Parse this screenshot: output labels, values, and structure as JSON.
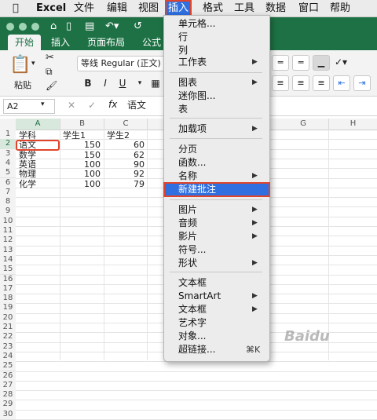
{
  "menubar": {
    "apple": "",
    "app": "Excel",
    "items": [
      "文件",
      "编辑",
      "视图",
      "插入",
      "格式",
      "工具",
      "数据",
      "窗口",
      "帮助"
    ]
  },
  "ribbon_tabs": [
    "开始",
    "插入",
    "页面布局",
    "公式"
  ],
  "ribbon": {
    "paste_label": "粘贴",
    "font_name": "等线 Regular (正文)",
    "bold": "B",
    "italic": "I",
    "underline": "U"
  },
  "formula_bar": {
    "name_box": "A2",
    "fx": "fx",
    "value": "语文"
  },
  "columns": [
    "A",
    "B",
    "C",
    "G",
    "H"
  ],
  "rows": [
    "1",
    "2",
    "3",
    "4",
    "5",
    "6",
    "7",
    "8",
    "9",
    "10",
    "11",
    "12",
    "13",
    "14",
    "15",
    "16",
    "17",
    "18",
    "19",
    "20",
    "21",
    "22",
    "23",
    "24",
    "25",
    "26",
    "27",
    "28",
    "29",
    "30"
  ],
  "cells": {
    "header": [
      "学科",
      "学生1",
      "学生2"
    ],
    "data": [
      [
        "语文",
        "150",
        "60"
      ],
      [
        "数学",
        "150",
        "62"
      ],
      [
        "英语",
        "100",
        "90"
      ],
      [
        "物理",
        "100",
        "92"
      ],
      [
        "化学",
        "100",
        "79"
      ]
    ]
  },
  "insert_menu": {
    "items": [
      {
        "label": "单元格...",
        "submenu": false
      },
      {
        "label": "行",
        "submenu": false
      },
      {
        "label": "列",
        "submenu": false
      },
      {
        "label": "工作表",
        "submenu": true
      },
      {
        "label": "图表",
        "submenu": true
      },
      {
        "label": "迷你图...",
        "submenu": false
      },
      {
        "label": "表",
        "submenu": false
      },
      {
        "label": "加载项",
        "submenu": true
      },
      {
        "label": "分页",
        "submenu": false
      },
      {
        "label": "函数...",
        "submenu": false
      },
      {
        "label": "名称",
        "submenu": true
      },
      {
        "label": "新建批注",
        "submenu": false,
        "selected": true
      },
      {
        "label": "图片",
        "submenu": true
      },
      {
        "label": "音频",
        "submenu": true
      },
      {
        "label": "影片",
        "submenu": true
      },
      {
        "label": "符号...",
        "submenu": false
      },
      {
        "label": "形状",
        "submenu": true
      },
      {
        "label": "文本框",
        "submenu": false
      },
      {
        "label": "SmartArt",
        "submenu": true
      },
      {
        "label": "文本框",
        "submenu": true
      },
      {
        "label": "艺术字",
        "submenu": false
      },
      {
        "label": "对象...",
        "submenu": false
      },
      {
        "label": "超链接...",
        "submenu": false,
        "shortcut": "⌘K"
      }
    ]
  },
  "watermark": "Baidu"
}
